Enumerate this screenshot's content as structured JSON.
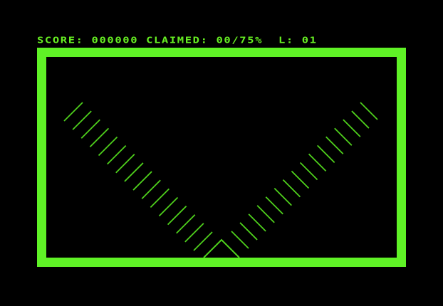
{
  "hud": {
    "score_label": "SCORE:",
    "score_value": "000000",
    "claimed_label": "CLAIMED:",
    "claimed_value": "00/75%",
    "level_label": "L:",
    "level_value": "01"
  },
  "colors": {
    "background": "#000000",
    "border": "#5ff226",
    "hud_text": "#66ee22",
    "hatch": "#4fd11c"
  },
  "icons": {
    "player_marker": "triangle-marker-icon"
  }
}
